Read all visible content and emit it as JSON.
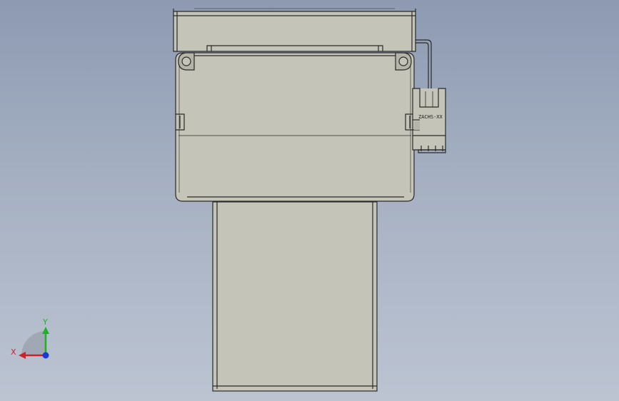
{
  "viewport": {
    "part_tag": "ZACHS-XX",
    "triad": {
      "x_label": "X",
      "y_label": "Y",
      "x_color": "#d0202a",
      "y_color": "#1fb02a",
      "z_color": "#1a3ad8"
    },
    "colors": {
      "background_top": "#8d9ab2",
      "background_bottom": "#bcc4d2",
      "part_face": "#c4c5b8",
      "edge": "#2a2a2a"
    }
  }
}
